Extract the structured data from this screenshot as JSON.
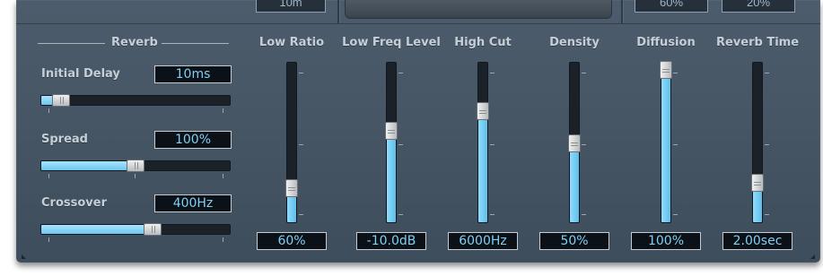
{
  "top": {
    "cropped_values": [
      "10m",
      "60%",
      "20%"
    ]
  },
  "reverb": {
    "title": "Reverb",
    "initial_delay": {
      "label": "Initial Delay",
      "value": "10ms",
      "level": 0.07
    },
    "spread": {
      "label": "Spread",
      "value": "100%",
      "level": 0.5
    },
    "crossover": {
      "label": "Crossover",
      "value": "400Hz",
      "level": 0.6
    }
  },
  "faders": [
    {
      "id": "low-ratio",
      "label": "Low Ratio",
      "value": "60%",
      "level": 0.22
    },
    {
      "id": "low-freq-level",
      "label": "Low Freq Level",
      "value": "-10.0dB",
      "level": 0.58
    },
    {
      "id": "high-cut",
      "label": "High Cut",
      "value": "6000Hz",
      "level": 0.7
    },
    {
      "id": "density",
      "label": "Density",
      "value": "50%",
      "level": 0.5
    },
    {
      "id": "diffusion",
      "label": "Diffusion",
      "value": "100%",
      "level": 0.97
    },
    {
      "id": "reverb-time",
      "label": "Reverb Time",
      "value": "2.00sec",
      "level": 0.25
    }
  ],
  "colors": {
    "panel": "#465665",
    "fill": "#7fd0f5",
    "value_text": "#7fd0f5",
    "label_text": "#c6ced6"
  }
}
